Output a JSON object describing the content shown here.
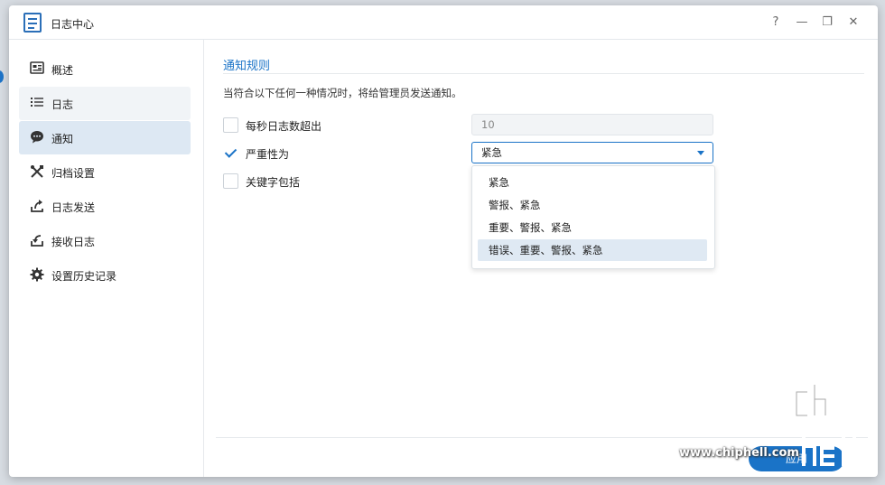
{
  "window": {
    "title": "日志中心"
  },
  "titlebar_controls": [
    "?",
    "—",
    "❐",
    "✕"
  ],
  "sidebar": {
    "items": [
      {
        "label": "概述",
        "icon": "overview-icon"
      },
      {
        "label": "日志",
        "icon": "list-icon"
      },
      {
        "label": "通知",
        "icon": "chat-icon"
      },
      {
        "label": "归档设置",
        "icon": "tools-icon"
      },
      {
        "label": "日志发送",
        "icon": "send-icon"
      },
      {
        "label": "接收日志",
        "icon": "receive-icon"
      },
      {
        "label": "设置历史记录",
        "icon": "gear-icon"
      }
    ],
    "active": "通知"
  },
  "main": {
    "section_title": "通知规则",
    "description": "当符合以下任何一种情况时，将给管理员发送通知。",
    "rules": [
      {
        "label": "每秒日志数超出",
        "checked": false,
        "value": "10"
      },
      {
        "label": "严重性为",
        "checked": true,
        "value": "紧急"
      },
      {
        "label": "关键字包括",
        "checked": false
      }
    ],
    "severity_options": [
      "紧急",
      "警报、紧急",
      "重要、警报、紧急",
      "错误、重要、警报、紧急"
    ],
    "highlighted_option": "错误、重要、警报、紧急"
  },
  "footer": {
    "apply_label": "应用"
  },
  "watermark": {
    "text": "www.chiphell.com",
    "logo_text": "chip hell"
  },
  "colors": {
    "accent": "#1a73c7",
    "active_nav": "#dde8f3",
    "highlight": "#dfe9f3"
  }
}
